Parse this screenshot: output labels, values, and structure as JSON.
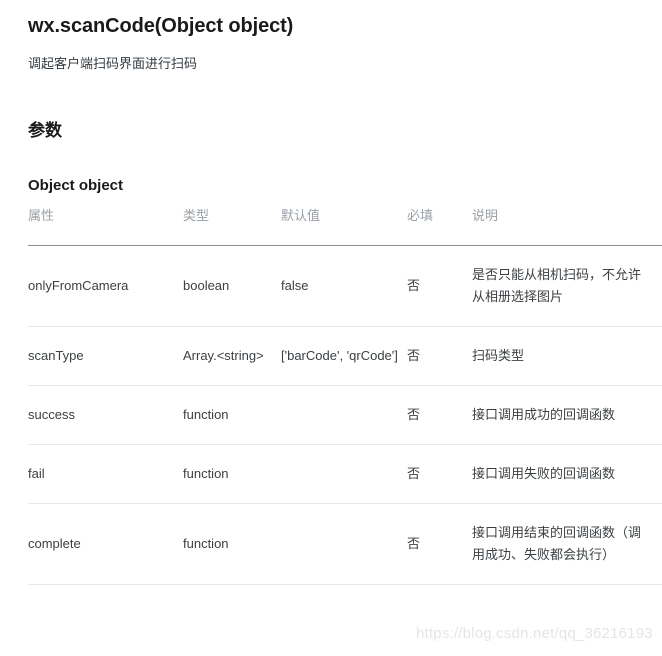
{
  "api": {
    "title": "wx.scanCode(Object object)",
    "description": "调起客户端扫码界面进行扫码"
  },
  "sections": {
    "parameters_heading": "参数",
    "object_heading": "Object object"
  },
  "table": {
    "headers": {
      "attribute": "属性",
      "type": "类型",
      "default": "默认值",
      "required": "必填",
      "description": "说明"
    },
    "rows": [
      {
        "attribute": "onlyFromCamera",
        "type": "boolean",
        "default": "false",
        "required": "否",
        "description": "是否只能从相机扫码，不允许从相册选择图片"
      },
      {
        "attribute": "scanType",
        "type": "Array.<string>",
        "default": "['barCode', 'qrCode']",
        "required": "否",
        "description": "扫码类型"
      },
      {
        "attribute": "success",
        "type": "function",
        "default": "",
        "required": "否",
        "description": "接口调用成功的回调函数"
      },
      {
        "attribute": "fail",
        "type": "function",
        "default": "",
        "required": "否",
        "description": "接口调用失败的回调函数"
      },
      {
        "attribute": "complete",
        "type": "function",
        "default": "",
        "required": "否",
        "description": "接口调用结束的回调函数（调用成功、失败都会执行）"
      }
    ]
  },
  "watermark": {
    "text": "https://blog.csdn.net/qq_36216193"
  },
  "colors": {
    "heading": "#1a1a1a",
    "body_text": "#3c4043",
    "table_header_text": "#9aa0a6",
    "header_border": "#8a8f94",
    "row_divider": "#e8e8e8",
    "watermark": "#e3e6e8",
    "background": "#ffffff"
  }
}
